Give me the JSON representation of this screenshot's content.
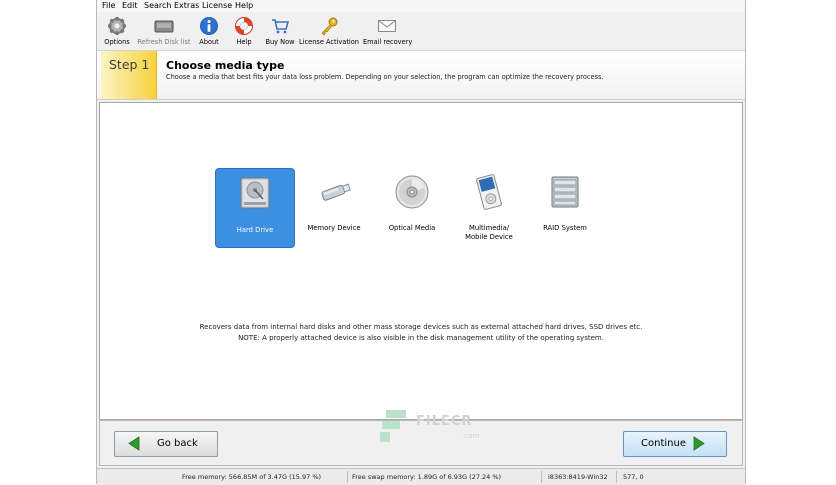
{
  "menu": [
    "File",
    "Edit",
    "Search",
    "Extras",
    "License",
    "Help"
  ],
  "toolbar": [
    {
      "label": "Options",
      "icon": "gear-icon"
    },
    {
      "label": "Refresh Disk list",
      "icon": "disk-refresh-icon"
    },
    {
      "label": "About",
      "icon": "info-icon"
    },
    {
      "label": "Help",
      "icon": "lifebuoy-icon"
    },
    {
      "label": "Buy Now",
      "icon": "shopping-cart-icon"
    },
    {
      "label": "License Activation",
      "icon": "key-icon"
    },
    {
      "label": "Email recovery",
      "icon": "envelope-icon"
    }
  ],
  "step": {
    "label": "Step 1",
    "title": "Choose media type",
    "description": "Choose a media that best fits your data loss problem. Depending on your selection, the program can optimize the recovery process."
  },
  "media": [
    {
      "label": "Hard Drive",
      "icon": "hard-drive-icon",
      "selected": true
    },
    {
      "label": "Memory Device",
      "icon": "usb-stick-icon",
      "selected": false
    },
    {
      "label": "Optical Media",
      "icon": "optical-disc-icon",
      "selected": false
    },
    {
      "label_line1": "Multimedia/",
      "label_line2": "Mobile Device",
      "icon": "media-player-icon",
      "selected": false
    },
    {
      "label": "RAID System",
      "icon": "raid-icon",
      "selected": false
    }
  ],
  "description": {
    "line1": "Recovers data from internal hard disks and other mass storage devices such as external attached hard drives, SSD drives etc.",
    "line2": "NOTE: A properly attached device is also visible in the disk management utility of the operating system."
  },
  "nav": {
    "back_label": "Go back",
    "continue_label": "Continue"
  },
  "status": {
    "free_memory": "Free memory: 566.85M of 3.47G (15.97 %)",
    "free_swap": "Free swap memory: 1.89G of 6.93G (27.24 %)",
    "build": "i8363:8419-Win32",
    "coords": "577, 0"
  },
  "watermark": {
    "text": "FILECR",
    "sub": ".com"
  },
  "colors": {
    "accent": "#3d8fe2",
    "step": "#f7d23e",
    "arrow": "#2e9b2e"
  }
}
